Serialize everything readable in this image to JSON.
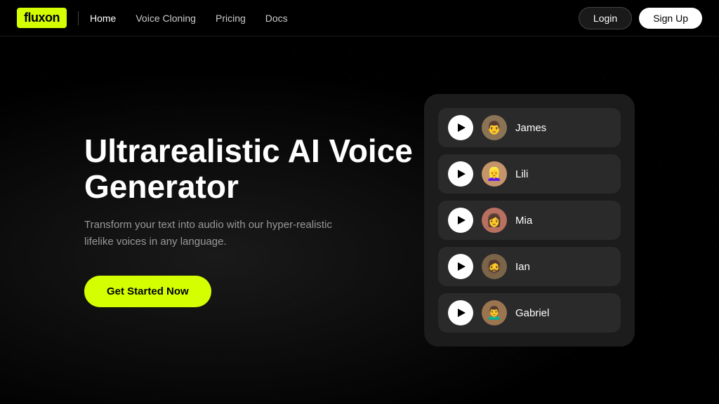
{
  "brand": {
    "name": "fluxon"
  },
  "nav": {
    "divider": "|",
    "links": [
      {
        "id": "home",
        "label": "Home",
        "active": true
      },
      {
        "id": "voice-cloning",
        "label": "Voice Cloning",
        "active": false
      },
      {
        "id": "pricing",
        "label": "Pricing",
        "active": false
      },
      {
        "id": "docs",
        "label": "Docs",
        "active": false
      }
    ],
    "login_label": "Login",
    "signup_label": "Sign Up"
  },
  "hero": {
    "title": "Ultrarealistic AI Voice Generator",
    "subtitle": "Transform your text into audio with our hyper-realistic lifelike voices in any language.",
    "cta_label": "Get Started Now"
  },
  "voices": [
    {
      "id": "james",
      "name": "James",
      "emoji": "👨"
    },
    {
      "id": "lili",
      "name": "Lili",
      "emoji": "👱‍♀️"
    },
    {
      "id": "mia",
      "name": "Mia",
      "emoji": "👩"
    },
    {
      "id": "ian",
      "name": "Ian",
      "emoji": "🧔"
    },
    {
      "id": "gabriel",
      "name": "Gabriel",
      "emoji": "👨‍🦱"
    }
  ]
}
